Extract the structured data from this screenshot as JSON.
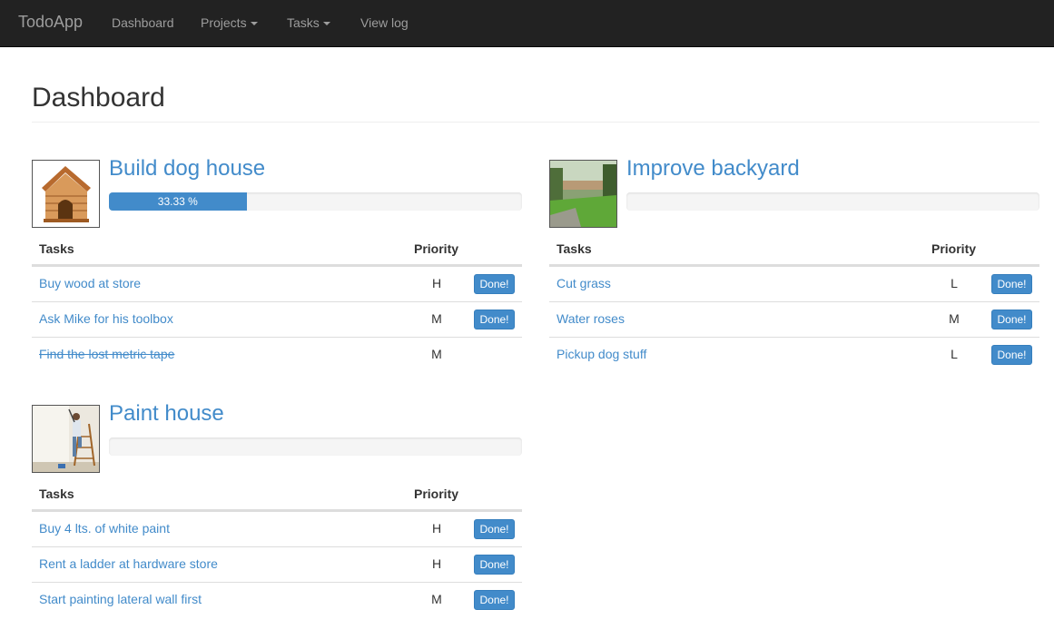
{
  "navbar": {
    "brand": "TodoApp",
    "items": [
      {
        "label": "Dashboard",
        "dropdown": false
      },
      {
        "label": "Projects",
        "dropdown": true
      },
      {
        "label": "Tasks",
        "dropdown": true
      },
      {
        "label": "View log",
        "dropdown": false
      }
    ]
  },
  "page": {
    "title": "Dashboard"
  },
  "table_headers": {
    "tasks": "Tasks",
    "priority": "Priority"
  },
  "done_label": "Done!",
  "projects": [
    {
      "title": "Build dog house",
      "image": "dog-house",
      "progress": 33.33,
      "progress_label": "33.33 %",
      "tasks": [
        {
          "name": "Buy wood at store",
          "priority": "H",
          "completed": false
        },
        {
          "name": "Ask Mike for his toolbox",
          "priority": "M",
          "completed": false
        },
        {
          "name": "Find the lost metric tape",
          "priority": "M",
          "completed": true
        }
      ]
    },
    {
      "title": "Improve backyard",
      "image": "backyard",
      "progress": 0,
      "progress_label": "",
      "tasks": [
        {
          "name": "Cut grass",
          "priority": "L",
          "completed": false
        },
        {
          "name": "Water roses",
          "priority": "M",
          "completed": false
        },
        {
          "name": "Pickup dog stuff",
          "priority": "L",
          "completed": false
        }
      ]
    },
    {
      "title": "Paint house",
      "image": "painter",
      "progress": 0,
      "progress_label": "",
      "tasks": [
        {
          "name": "Buy 4 lts. of white paint",
          "priority": "H",
          "completed": false
        },
        {
          "name": "Rent a ladder at hardware store",
          "priority": "H",
          "completed": false
        },
        {
          "name": "Start painting lateral wall first",
          "priority": "M",
          "completed": false
        }
      ]
    }
  ]
}
